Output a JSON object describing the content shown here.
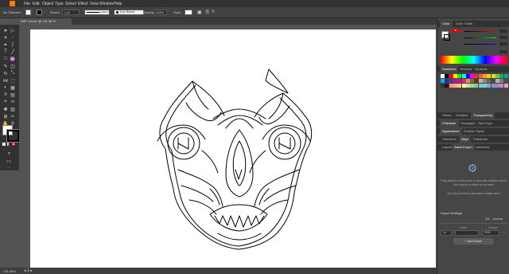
{
  "menu": [
    "File",
    "Edit",
    "Object",
    "Type",
    "Select",
    "Effect",
    "View",
    "Window",
    "Help"
  ],
  "control": {
    "selection": "No Selection",
    "stroke_label": "Stroke:",
    "stroke_value": "1 pt",
    "profile": "Uniform",
    "brush": "5 pt. Round",
    "opacity_label": "Opacity:",
    "opacity_value": "100%",
    "style_label": "Style:"
  },
  "document_tab": "WET-Art.ai* @ 131.36 % (RGB/Preview)",
  "status": {
    "zoom": "131.36%"
  },
  "panels": {
    "color_tabs": [
      "Color",
      "Color Guide"
    ],
    "color_values": [
      "",
      "",
      "",
      ""
    ],
    "swatch_tabs": [
      "Swatches",
      "Brushes",
      "Symbols"
    ],
    "stroke_tabs": [
      "Stroke",
      "Gradient",
      "Transparency"
    ],
    "char_tabs": [
      "Character",
      "Paragraph",
      "OpenType"
    ],
    "appearance_tabs": [
      "Appearance",
      "Graphic Styles"
    ],
    "align_tabs": [
      "Transform",
      "Align",
      "Pathfinder"
    ],
    "export_tabs": [
      "Layers",
      "Asset Export",
      "Artboards"
    ],
    "export_hint1": "Drag artwork to this panel to generate multiple assets. Don't group is added as an asset.",
    "export_hint2": "Alt-Drag artwork to generate a single asset.",
    "export_settings": "Export Settings",
    "scale_value": "1x",
    "suffix_label": "Suffix",
    "format_label": "Format",
    "format_value": "PNG",
    "ios_label": "iOS",
    "android_label": "Android",
    "add_scale": "+ Add Scale"
  },
  "colors": {
    "accent": "#ff7c00",
    "chrome": "#323232",
    "panel": "#464646",
    "canvas": "#535353"
  },
  "swatches": [
    "#ffffff",
    "#000000",
    "#ff0000",
    "#ffff00",
    "#00ff00",
    "#00ffff",
    "#0000ff",
    "#ff00ff",
    "#e8332a",
    "#f0643a",
    "#f6a21c",
    "#fad20c",
    "#d3e21e",
    "#7bc043",
    "#1db04b",
    "#00a99d",
    "#00aeef",
    "#2e3192",
    "#662d91",
    "#92278f",
    "#ec008c",
    "#ed1c79",
    "#c69c6d",
    "#8c6239",
    "#603913",
    "#c7b299",
    "#998675",
    "#736357",
    "#534741",
    "#b3b3b3",
    "#808080",
    "#4d4d4d",
    "#333333",
    "#1a1a1a",
    "#f7977a",
    "#fbad82",
    "#fdc68c",
    "#fff799",
    "#c4df9b",
    "#a3d39c",
    "#82ca9d",
    "#7accc8",
    "#6dcff6",
    "#7da7d9",
    "#8393ca",
    "#a187be",
    "#bc8dbf",
    "#f49ac1"
  ]
}
